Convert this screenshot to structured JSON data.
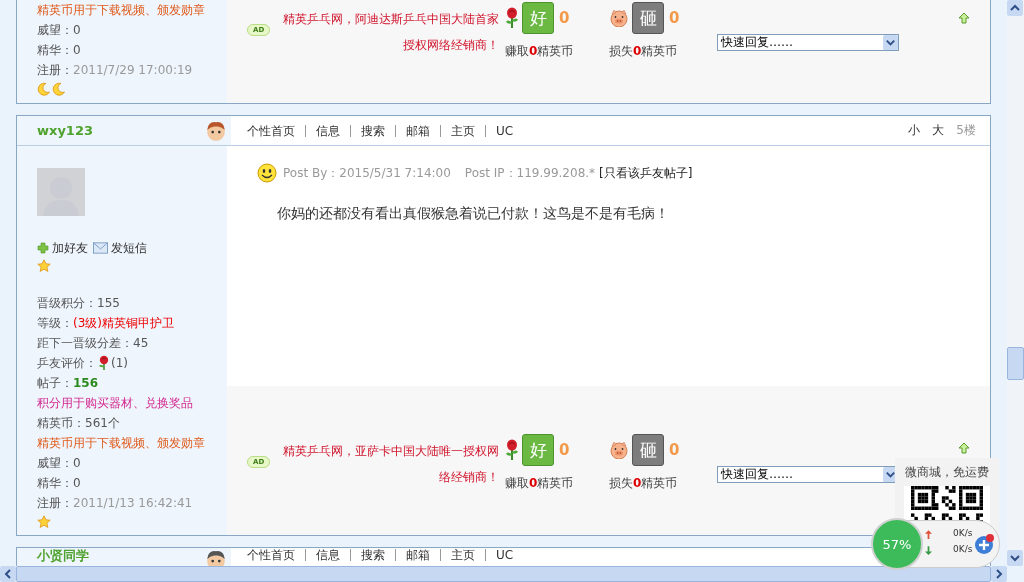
{
  "posts": [
    {
      "sidebar": {
        "stats": [
          {
            "kind": "note",
            "label": "精英币用于下载视频、颁发勋章",
            "color": "#e05a1b"
          },
          {
            "kind": "plain",
            "label": "威望：",
            "value": "0"
          },
          {
            "kind": "plain",
            "label": "精华：",
            "value": "0"
          },
          {
            "kind": "date",
            "label": "注册：",
            "value": "2011/7/29 17:00:19"
          }
        ],
        "rank_icons": [
          {
            "kind": "moon"
          },
          {
            "kind": "moon"
          }
        ]
      },
      "footer": {
        "ad_tag": "AD",
        "ad_text": "精英乒乓网，阿迪达斯乒乓中国大陆首家授权网络经销商！",
        "good": {
          "badge": "好",
          "count": "0",
          "caption": "赚取**0**精英币"
        },
        "bad": {
          "badge": "砸",
          "count": "0",
          "caption": "损失**0**精英币"
        },
        "quick_reply": {
          "value": "快速回复……"
        }
      }
    },
    {
      "header": {
        "username": "wxy123",
        "links": [
          "个性首页",
          "信息",
          "搜索",
          "邮箱",
          "主页",
          "UC"
        ],
        "size_links": [
          "小",
          "大"
        ],
        "floor": "5楼"
      },
      "sidebar": {
        "actions": [
          {
            "kind": "add",
            "label": "加好友"
          },
          {
            "kind": "mail",
            "label": "发短信"
          }
        ],
        "titles": [
          {
            "kind": "star"
          }
        ],
        "stats": [
          {
            "kind": "plain",
            "label": "晋级积分：",
            "value": "155"
          },
          {
            "kind": "level",
            "label": "等级：",
            "value": "(3级)精英铜甲护卫"
          },
          {
            "kind": "plain",
            "label": "距下一晋级分差：",
            "value": "45"
          },
          {
            "kind": "rating",
            "label": "乒友评价：",
            "value": "(1)"
          },
          {
            "kind": "posts",
            "label": "帖子：",
            "value": "156"
          },
          {
            "kind": "note",
            "label": "积分用于购买器材、兑换奖品",
            "color": "#d4278f"
          },
          {
            "kind": "plain",
            "label": "精英币：",
            "value": "561个"
          },
          {
            "kind": "note",
            "label": "精英币用于下载视频、颁发勋章",
            "color": "#e05a1b"
          },
          {
            "kind": "plain",
            "label": "威望：",
            "value": "0"
          },
          {
            "kind": "plain",
            "label": "精华：",
            "value": "0"
          },
          {
            "kind": "date",
            "label": "注册：",
            "value": "2011/1/13 16:42:41"
          }
        ],
        "rank_icons": [
          {
            "kind": "star"
          }
        ]
      },
      "body": {
        "posted_by": "Post By：2015/5/31 7:14:00",
        "post_ip": "Post IP：119.99.208.*",
        "only_link": "[只看该乒友帖子]",
        "content": "你妈的还都没有看出真假猴急着说已付款！这鸟是不是有毛病！"
      },
      "footer": {
        "ad_tag": "AD",
        "ad_text": "精英乒乓网，亚萨卡中国大陆唯一授权网络经销商！",
        "good": {
          "badge": "好",
          "count": "0",
          "caption": "赚取**0**精英币"
        },
        "bad": {
          "badge": "砸",
          "count": "0",
          "caption": "损失**0**精英币"
        },
        "quick_reply": {
          "value": "快速回复……"
        }
      }
    },
    {
      "header": {
        "username": "小贤同学",
        "links": [
          "个性首页",
          "信息",
          "搜索",
          "邮箱",
          "主页",
          "UC"
        ]
      }
    }
  ],
  "qr_widget": {
    "caption": "微商城，免运费"
  },
  "net_meter": {
    "percent": "57%",
    "up": "0K/s",
    "down": "0K/s"
  }
}
